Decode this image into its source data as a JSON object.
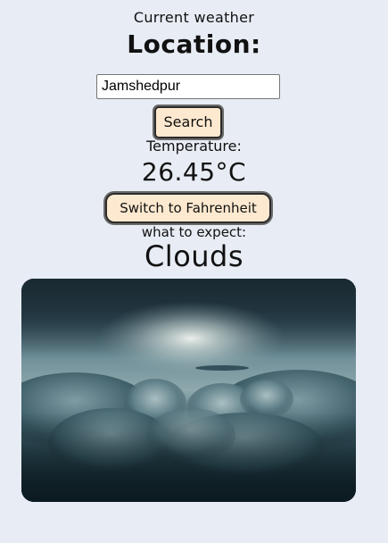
{
  "header": {
    "subtitle": "Current weather",
    "title": "Location:"
  },
  "search": {
    "value": "Jamshedpur",
    "button_label": "Search"
  },
  "temperature": {
    "label": "Temperature:",
    "value": "26.45°C",
    "switch_label": "Switch to Fahrenheit"
  },
  "forecast": {
    "label": "what to expect:",
    "description": "Clouds"
  },
  "colors": {
    "background": "#e8ecf4",
    "button_fill": "#fde9cf"
  }
}
